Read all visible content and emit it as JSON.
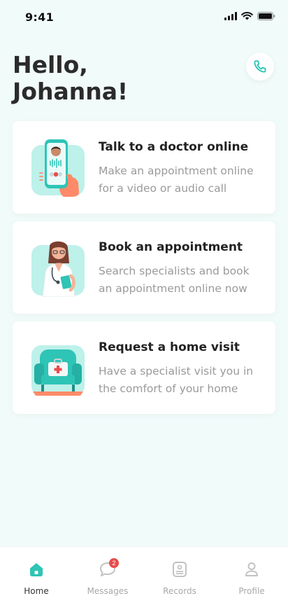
{
  "status": {
    "time": "9:41"
  },
  "greeting": {
    "line1": "Hello,",
    "line2": "Johanna!"
  },
  "call_button": {
    "icon": "phone-icon"
  },
  "cards": [
    {
      "title": "Talk to a doctor online",
      "desc_line1": "Make an appointment online",
      "desc_line2": "for a video or audio call"
    },
    {
      "title": "Book an appointment",
      "desc_line1": "Search specialists and book",
      "desc_line2": "an appointment online now"
    },
    {
      "title": "Request a home visit",
      "desc_line1": "Have a specialist visit you in",
      "desc_line2": "the comfort of your home"
    }
  ],
  "tabs": [
    {
      "label": "Home",
      "icon": "home-icon",
      "active": true
    },
    {
      "label": "Messages",
      "icon": "chat-icon",
      "badge": "2"
    },
    {
      "label": "Records",
      "icon": "records-icon"
    },
    {
      "label": "Profile",
      "icon": "user-icon"
    }
  ],
  "colors": {
    "accent": "#2ec4b6",
    "mint": "#bdf1ea",
    "badge": "#e74c4c",
    "background": "#f1fbfa"
  }
}
